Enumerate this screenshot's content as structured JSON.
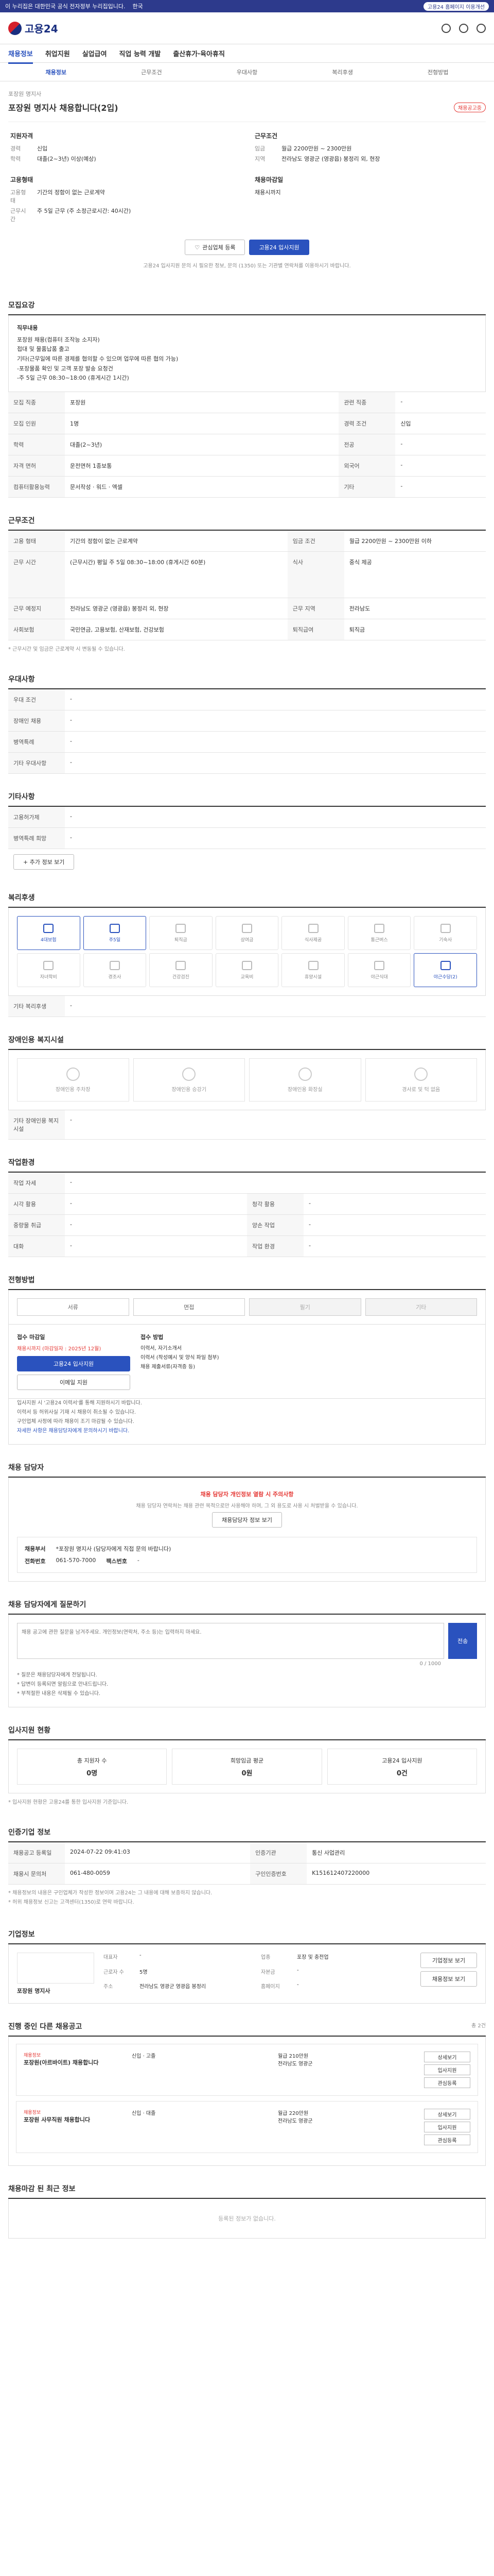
{
  "topbar": {
    "notice": "이 누리집은 대한민국 공식 전자정부 누리집입니다.",
    "lang": "한국",
    "login": "고용24 홈페이지 이용개선"
  },
  "header": {
    "brand": "고용24"
  },
  "gnb": [
    "채용정보",
    "취업지원",
    "실업급여",
    "직업 능력 개발",
    "출산휴가·육아휴직"
  ],
  "subtabs": [
    "채용정보",
    "근무조건",
    "우대사항",
    "복리후생",
    "전형방법"
  ],
  "job": {
    "company": "포장원 명지사",
    "title": "포장원 명지사 채용합니다(2입)",
    "badge": "채용공고중",
    "group1_title": "지원자격",
    "group1": [
      {
        "k": "경력",
        "v": "신입"
      },
      {
        "k": "학력",
        "v": "대졸(2~3년) 이상(예상)"
      }
    ],
    "group2_title": "근무조건",
    "group2": [
      {
        "k": "임금",
        "v": "월급 2200만원 ~ 2300만원"
      },
      {
        "k": "지역",
        "v": "전라남도 영광군 (영광읍) 봉정리 외, 현장"
      }
    ],
    "group3_title": "고용형태",
    "group3": [
      {
        "k": "고용형태",
        "v": "기간의 정함이 없는 근로계약"
      },
      {
        "k": "근무시간",
        "v": "주 5일 근무 (주 소정근로시간: 40시간)"
      }
    ],
    "group4_title": "채용마감일",
    "group4": [
      {
        "k": "",
        "v": "채용시까지"
      }
    ],
    "btn_interest": "관심업체 등록",
    "btn_apply": "고용24 입사지원",
    "notice": "고용24 입사지원 문의 시 필요한 정보, 문의 (1350) 또는 기관별 연락처를 이용하시기 바랍니다."
  },
  "recruit": {
    "title": "모집요강",
    "desc_heading": "직무내용",
    "desc_lines": [
      "포장원 채용(컴퓨터 조작능 소지자)",
      "접대 및 물품납품 출고",
      "기타(근무일에 따른 경제를 협의할 수 있으며 업무에 따른 협의 가능)",
      "-포장물품 확인 및 고객 포장 발송 요청건",
      "-주 5일 근무 08:30~18:00 (휴게시간 1시간)"
    ],
    "rows": [
      {
        "k": "모집 직종",
        "v": "포장원",
        "k2": "관련 직종",
        "v2": "-"
      },
      {
        "k": "모집 인원",
        "v": "1명",
        "k2": "경력 조건",
        "v2": "신입"
      },
      {
        "k": "학력",
        "v": "대졸(2~3년)",
        "k2": "전공",
        "v2": "-"
      },
      {
        "k": "자격 면허",
        "v": "운전면허 1종보통",
        "k2": "외국어",
        "v2": "-"
      },
      {
        "k": "컴퓨터활용능력",
        "v": "문서작성 · 워드 · 엑셀",
        "k2": "기타",
        "v2": "-"
      }
    ]
  },
  "work": {
    "title": "근무조건",
    "rows": [
      {
        "k": "고용 형태",
        "v": "기간의 정함이 없는 근로계약",
        "k2": "임금 조건",
        "v2": "월급 2200만원 ~ 2300만원 이하"
      },
      {
        "k": "근무 시간",
        "v": "(근무시간) 평일 주 5일 08:30~18:00 (휴게시간 60분)",
        "k2": "식사",
        "v2": "중식 제공"
      },
      {
        "k": "근무 예정지",
        "v": "전라남도 영광군 (영광읍) 봉정리 외, 현장",
        "k2": "근무 지역",
        "v2": "전라남도"
      },
      {
        "k": "사회보험",
        "v": "국민연금, 고용보험, 산재보험, 건강보험",
        "k2": "퇴직급여",
        "v2": "퇴직금"
      }
    ],
    "note": "* 근무시간 및 임금은 근로계약 시 변동될 수 있습니다."
  },
  "prefer": {
    "title": "우대사항",
    "rows": [
      {
        "k": "우대 조건",
        "v": "-"
      },
      {
        "k": "장애인 채용",
        "v": "-"
      },
      {
        "k": "병역특례",
        "v": "-"
      },
      {
        "k": "기타 우대사항",
        "v": "-"
      }
    ]
  },
  "etc": {
    "title": "기타사항",
    "rows": [
      {
        "k": "고용허가제",
        "v": "-"
      },
      {
        "k": "병역특례 희망",
        "v": "-"
      }
    ],
    "add": "+ 추가 정보 보기"
  },
  "welfare": {
    "title": "복리후생",
    "items": [
      "4대보험",
      "주5일",
      "퇴직금",
      "상여금",
      "식사제공",
      "통근버스",
      "기숙사",
      "자녀학비",
      "경조사",
      "건강검진",
      "교육비",
      "휴양시설",
      "야근식대",
      "야근수당(2)"
    ],
    "active": [
      0,
      1,
      13
    ],
    "etc_label": "기타 복리후생",
    "etc_value": "-"
  },
  "disability": {
    "title": "장애인용 복지시설",
    "items": [
      "장애인용 주차장",
      "장애인용 승강기",
      "장애인용 화장실",
      "경사로 및 턱 없음"
    ],
    "etc_label": "기타 장애인용 복지시설",
    "etc_value": "-"
  },
  "workplace": {
    "title": "작업환경",
    "rows": [
      {
        "k": "작업 자세",
        "v": "-",
        "k2": "",
        "v2": ""
      },
      {
        "k": "시각 활용",
        "v": "-",
        "k2": "청각 활용",
        "v2": "-"
      },
      {
        "k": "중량물 취급",
        "v": "-",
        "k2": "양손 작업",
        "v2": "-"
      },
      {
        "k": "대화",
        "v": "-",
        "k2": "작업 환경",
        "v2": "-"
      }
    ]
  },
  "selection": {
    "title": "전형방법",
    "steps": [
      "서류",
      "면접",
      "필기",
      "기타"
    ]
  },
  "howto": {
    "method_title": "접수 마감일",
    "deadline": "채용시까지 (마감일자 : 2025년 12월)",
    "apply_btn": "고용24 입사지원",
    "email_btn": "이메일 지원",
    "docs_title": "접수 방법",
    "docs": [
      "이력서, 자기소개서",
      "이력서 (작성예시 및 양식 파일 첨부)",
      "채용 제출서류(자격증 등)"
    ],
    "bullets": [
      "입사지원 시 '고용24 이력서'를 통해 지원하시기 바랍니다.",
      "이력서 등 허위사실 기재 시 채용이 취소될 수 있습니다.",
      "구인업체 사정에 따라 채용이 조기 마감될 수 있습니다.",
      "자세한 사항은 채용담당자에게 문의하시기 바랍니다."
    ]
  },
  "manager": {
    "title": "채용 담당자",
    "warn": "채용 담당자 개인정보 열람 시 주의사항",
    "warn_text": "채용 담당자 연락처는 채용 관련 목적으로만 사용해야 하며, 그 외 용도로 사용 시 처벌받을 수 있습니다.",
    "show_btn": "채용담당자 정보 보기",
    "dept_k": "채용부서",
    "dept_v": "*포장원 명지사 (담당자에게 직접 문의 바랍니다)",
    "tel_k": "전화번호",
    "tel_v": "061-570-7000",
    "fax_k": "팩스번호",
    "fax_v": "-"
  },
  "qa": {
    "title": "채용 담당자에게 질문하기",
    "placeholder": "채용 공고에 관한 질문을 남겨주세요. 개인정보(연락처, 주소 등)는 입력하지 마세요.",
    "counter": "0 / 1000",
    "submit": "전송",
    "notes": [
      "* 질문은 채용담당자에게 전달됩니다.",
      "* 답변이 등록되면 알림으로 안내드립니다.",
      "* 부적절한 내용은 삭제될 수 있습니다."
    ]
  },
  "stats": {
    "title": "입사지원 현황",
    "items": [
      {
        "label": "총 지원자 수",
        "value": "0명"
      },
      {
        "label": "희망임금 평균",
        "value": "0원"
      },
      {
        "label": "고용24 입사지원",
        "value": "0건"
      }
    ],
    "note": "* 입사지원 현황은 고용24를 통한 입사지원 기준입니다."
  },
  "regist": {
    "title": "인증기업 정보",
    "rows": [
      {
        "k": "채용공고 등록일",
        "v": "2024-07-22 09:41:03",
        "k2": "인증기관",
        "v2": "통신 사업관리"
      },
      {
        "k": "채용시 문의처",
        "v": "061-480-0059",
        "k2": "구인인증번호",
        "v2": "K151612407220000"
      }
    ],
    "notes": [
      "* 채용정보의 내용은 구인업체가 작성한 정보이며 고용24는 그 내용에 대해 보증하지 않습니다.",
      "* 허위 채용정보 신고는 고객센터(1350)로 연락 바랍니다."
    ]
  },
  "corp": {
    "title": "기업정보",
    "name": "포장원 명지사",
    "fields": [
      {
        "k": "대표자",
        "v": "-"
      },
      {
        "k": "업종",
        "v": "포장 및 충전업"
      },
      {
        "k": "근로자 수",
        "v": "5명"
      },
      {
        "k": "자본금",
        "v": "-"
      },
      {
        "k": "주소",
        "v": "전라남도 영광군 영광읍 봉정리"
      },
      {
        "k": "홈페이지",
        "v": "-"
      }
    ],
    "btns": [
      "기업정보 보기",
      "채용정보 보기"
    ]
  },
  "others": {
    "title": "진행 중인 다른 채용공고",
    "count_text": "총 2건",
    "items": [
      {
        "cat": "채용정보",
        "title": "포장원(아르바이트) 채용합니다",
        "a": "신입 · 고졸",
        "b": "월급 210만원",
        "c": "전라남도 영광군"
      },
      {
        "cat": "채용정보",
        "title": "포장원 사무직원 채용합니다",
        "a": "신입 · 대졸",
        "b": "월급 220만원",
        "c": "전라남도 영광군"
      }
    ],
    "side": [
      "상세보기",
      "입사지원",
      "관심등록"
    ]
  },
  "recent": {
    "title": "채용마감 된 최근 정보",
    "empty": "등록된 정보가 없습니다."
  },
  "colors": {
    "primary": "#2a52be",
    "navy": "#2d3a8c",
    "alert": "#e53935"
  }
}
